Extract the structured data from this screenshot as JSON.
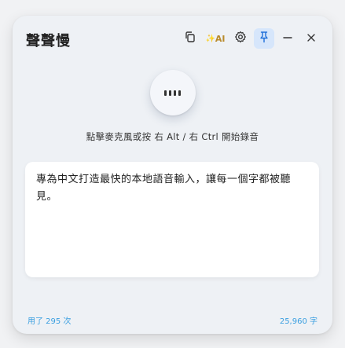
{
  "app": {
    "title": "聲聲慢"
  },
  "toolbar": {
    "ai_label": "AI",
    "ai_sparkle": "✨",
    "icons": [
      "copy-icon",
      "ai-sparkle-icon",
      "gear-icon",
      "pin-icon",
      "minimize-icon",
      "close-icon"
    ],
    "pin_active_color": "#d6e6fb"
  },
  "mic": {
    "icon": "audio-bars-icon"
  },
  "hint": {
    "text": "點擊麥克風或按 右 Alt / 右 Ctrl 開始錄音"
  },
  "transcript": {
    "text": "專為中文打造最快的本地語音輸入，讓每一個字都被聽見。"
  },
  "footer": {
    "usage": "用了 295 次",
    "char_count": "25,960 字"
  },
  "colors": {
    "accent": "#3a9fe0",
    "pin_accent": "#1e6fd9"
  }
}
